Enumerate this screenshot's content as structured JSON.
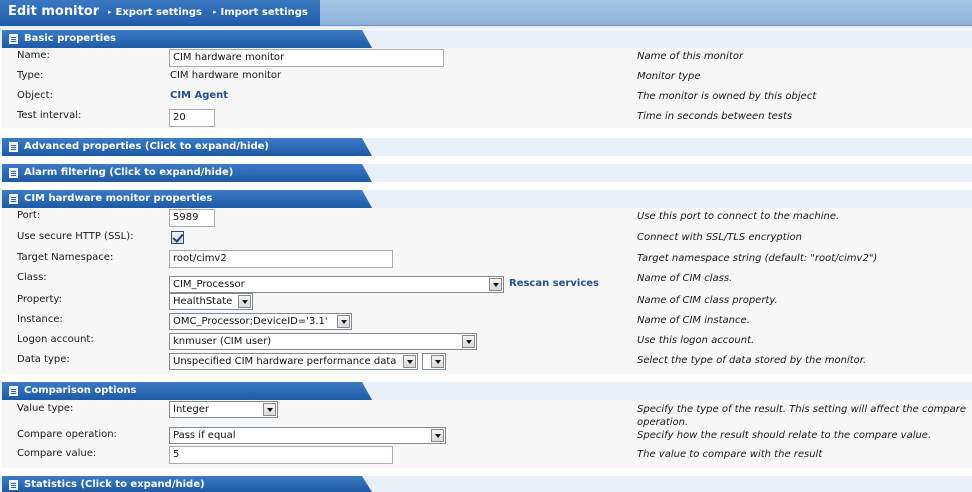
{
  "header": {
    "title": "Edit monitor",
    "links": [
      "Export settings",
      "Import settings"
    ]
  },
  "sections": {
    "basic": "Basic properties",
    "advanced": "Advanced properties (Click to expand/hide)",
    "alarm": "Alarm filtering (Click to expand/hide)",
    "cim": "CIM hardware monitor properties",
    "comparison": "Comparison options",
    "statistics": "Statistics (Click to expand/hide)"
  },
  "basic": {
    "name": {
      "label": "Name:",
      "value": "CIM hardware monitor",
      "desc": "Name of this monitor"
    },
    "type": {
      "label": "Type:",
      "value": "CIM hardware monitor",
      "desc": "Monitor type"
    },
    "object": {
      "label": "Object:",
      "value": "CIM Agent",
      "desc": "The monitor is owned by this object"
    },
    "interval": {
      "label": "Test interval:",
      "value": "20",
      "desc": "Time in seconds between tests"
    }
  },
  "cim": {
    "port": {
      "label": "Port:",
      "value": "5989",
      "desc": "Use this port to connect to the machine."
    },
    "ssl": {
      "label": "Use secure HTTP (SSL):",
      "checked": true,
      "desc": "Connect with SSL/TLS encryption"
    },
    "namespace": {
      "label": "Target Namespace:",
      "value": "root/cimv2",
      "desc": "Target namespace string (default: \"root/cimv2\")"
    },
    "class": {
      "label": "Class:",
      "value": "CIM_Processor",
      "rescan": "Rescan services",
      "desc": "Name of CIM class."
    },
    "property": {
      "label": "Property:",
      "value": "HealthState",
      "desc": "Name of CIM class property."
    },
    "instance": {
      "label": "Instance:",
      "value": "OMC_Processor;DeviceID='3.1'",
      "desc": "Name of CIM instance."
    },
    "logon": {
      "label": "Logon account:",
      "value": "knmuser (CIM user)",
      "desc": "Use this logon account."
    },
    "datatype": {
      "label": "Data type:",
      "value": "Unspecified CIM hardware performance data",
      "value2": "",
      "desc": "Select the type of data stored by the monitor."
    }
  },
  "comparison": {
    "valuetype": {
      "label": "Value type:",
      "value": "Integer",
      "desc": "Specify the type of the result. This setting will affect the compare operation."
    },
    "operation": {
      "label": "Compare operation:",
      "value": "Pass if equal",
      "desc": "Specify how the result should relate to the compare value."
    },
    "compare": {
      "label": "Compare value:",
      "value": "5",
      "desc": "The value to compare with the result"
    }
  },
  "colors": {
    "accent": "#1e5aa5",
    "topbar": "#9cbde0",
    "link": "#1f4f96"
  }
}
